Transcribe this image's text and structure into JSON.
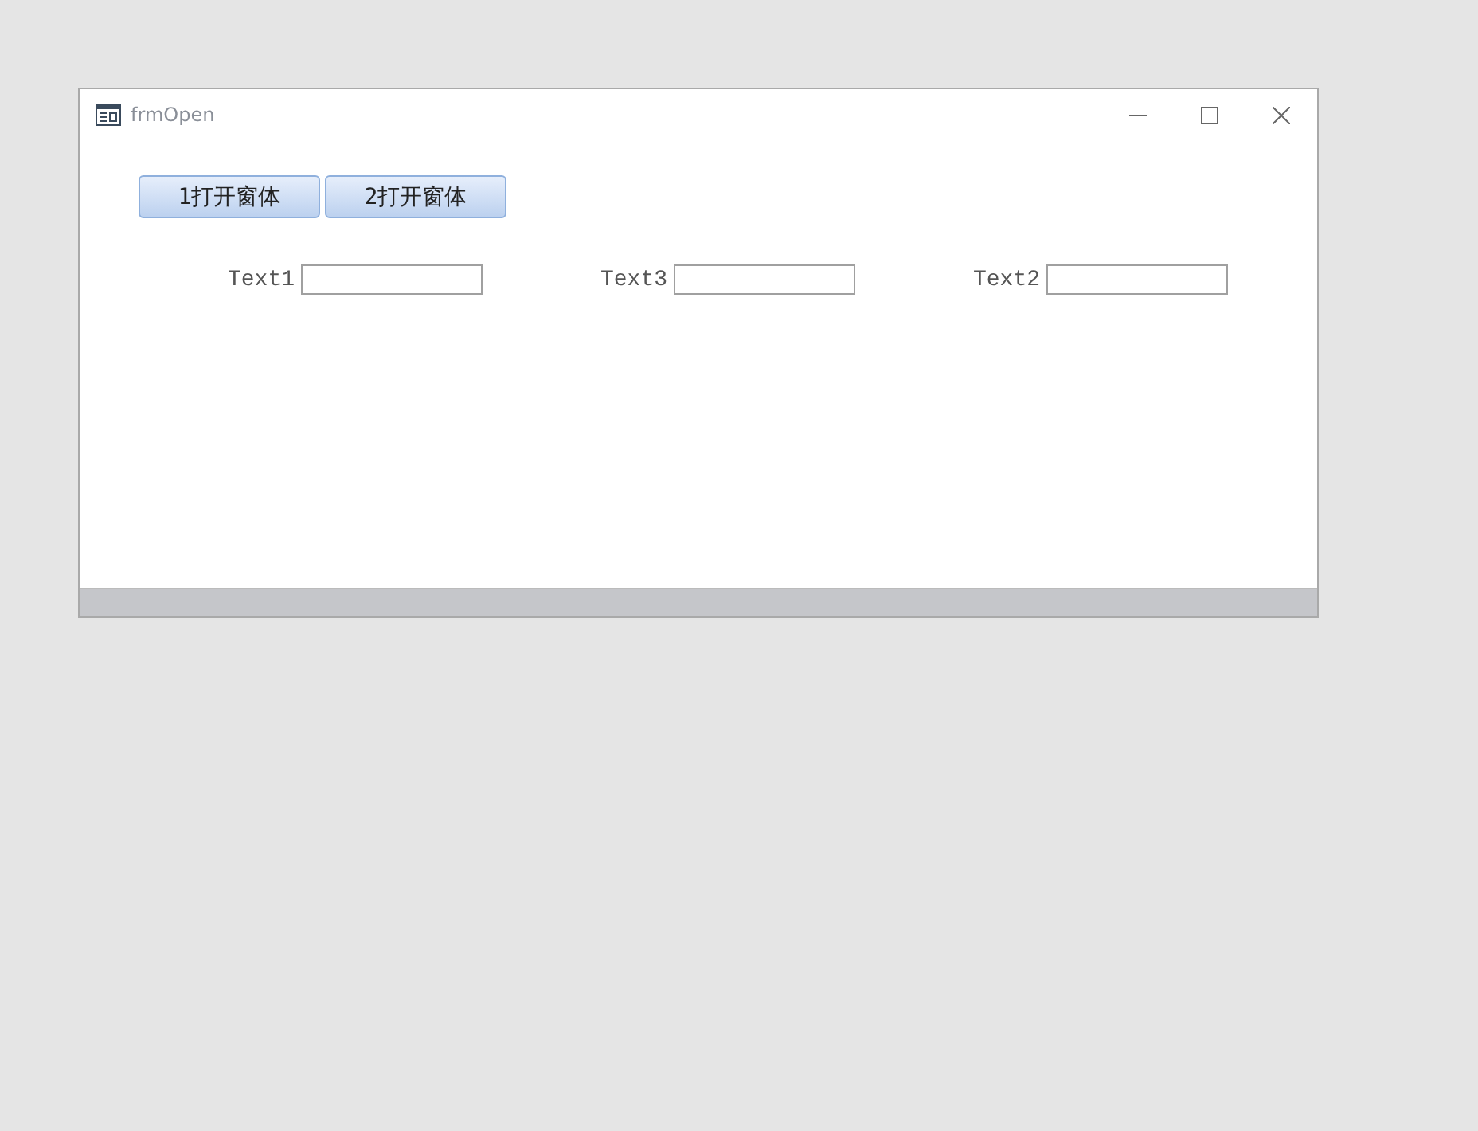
{
  "window": {
    "title": "frmOpen"
  },
  "buttons": [
    "1打开窗体",
    "2打开窗体"
  ],
  "fields": [
    {
      "label": "Text1"
    },
    {
      "label": "Text3"
    },
    {
      "label": "Text2"
    }
  ]
}
